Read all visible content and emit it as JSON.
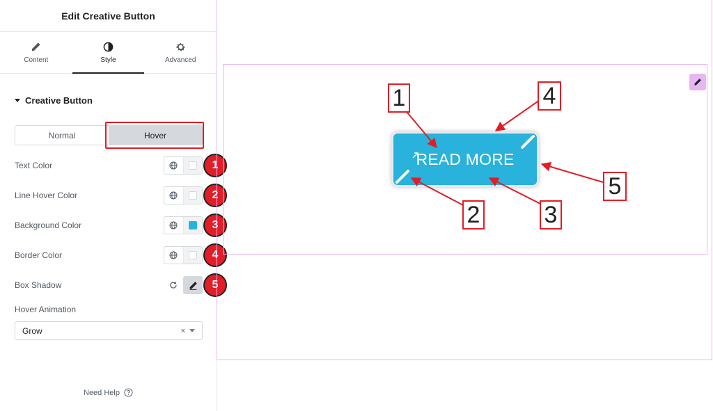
{
  "panel": {
    "title": "Edit Creative Button",
    "tabs": [
      {
        "label": "Content",
        "icon": "pencil-icon"
      },
      {
        "label": "Style",
        "icon": "contrast-icon"
      },
      {
        "label": "Advanced",
        "icon": "gear-icon"
      }
    ],
    "section_title": "Creative Button",
    "state_tabs": {
      "normal": "Normal",
      "hover": "Hover"
    },
    "rows": [
      {
        "label": "Text Color",
        "swatch": "#ffffff",
        "badge": "1"
      },
      {
        "label": "Line Hover Color",
        "swatch": "#ffffff",
        "badge": "2"
      },
      {
        "label": "Background Color",
        "swatch": "#28b2dc",
        "badge": "3"
      },
      {
        "label": "Border Color",
        "swatch": "#ffffff",
        "badge": "4"
      },
      {
        "label": "Box Shadow",
        "badge": "5"
      }
    ],
    "hover_animation": {
      "label": "Hover Animation",
      "value": "Grow",
      "clear": "×"
    },
    "need_help": "Need Help"
  },
  "preview": {
    "button_label": "READ MORE",
    "button_color": "#28b2dc"
  },
  "annotations": {
    "callouts": [
      "1",
      "2",
      "3",
      "4",
      "5"
    ],
    "color": "#e11d26"
  }
}
